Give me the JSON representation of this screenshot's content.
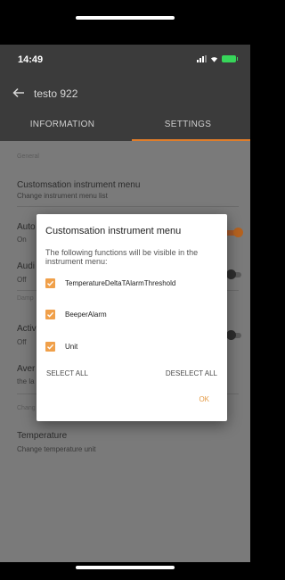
{
  "status": {
    "time": "14:49"
  },
  "app_bar": {
    "title": "testo 922"
  },
  "tabs": [
    {
      "label": "INFORMATION",
      "selected": false
    },
    {
      "label": "SETTINGS",
      "selected": true
    }
  ],
  "colors": {
    "accent": "#e07d2a",
    "checkbox": "#f0a04a",
    "ok": "#e49a44"
  },
  "settings": {
    "general_header": "General",
    "customisation": {
      "title": "Customsation instrument menu",
      "subtitle": "Change instrument menu list"
    },
    "auto": {
      "title": "Auto",
      "value": "On",
      "toggle_on": true
    },
    "audi": {
      "title": "Audi",
      "value": "Off",
      "toggle_on": false
    },
    "damp_header": "Damp",
    "activ": {
      "title": "Activ",
      "value": "Off",
      "toggle_on": false
    },
    "aver": {
      "title": "Aver",
      "subtitle": "the la"
    },
    "chang_header": "Chang",
    "temperature": {
      "title": "Temperature",
      "subtitle": "Change temperature unit"
    }
  },
  "dialog": {
    "title": "Customsation instrument menu",
    "description": "The following functions will be visible in the instrument menu:",
    "options": [
      {
        "label": "TemperatureDeltaTAlarmThreshold",
        "checked": true
      },
      {
        "label": "BeeperAlarm",
        "checked": true
      },
      {
        "label": "Unit",
        "checked": true
      }
    ],
    "select_all": "SELECT ALL",
    "deselect_all": "DESELECT ALL",
    "ok": "OK"
  }
}
